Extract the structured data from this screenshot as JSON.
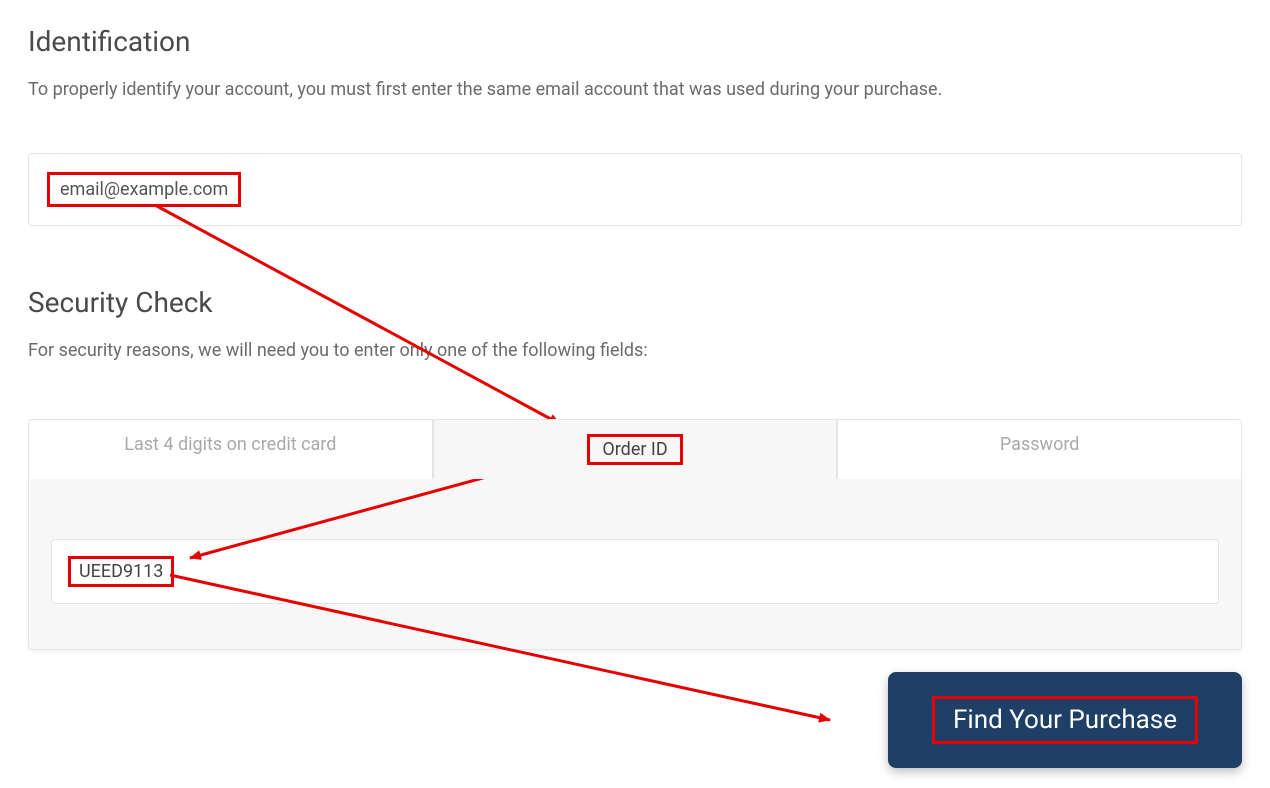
{
  "identification": {
    "heading": "Identification",
    "desc": "To properly identify your account, you must first enter the same email account that was used during your purchase.",
    "email_value": "email@example.com"
  },
  "security": {
    "heading": "Security Check",
    "desc": "For security reasons, we will need you to enter only one of the following fields:",
    "tabs": {
      "cc": "Last 4 digits on credit card",
      "order": "Order ID",
      "password": "Password"
    },
    "order_value": "UEED9113"
  },
  "button": {
    "label": "Find Your Purchase"
  }
}
